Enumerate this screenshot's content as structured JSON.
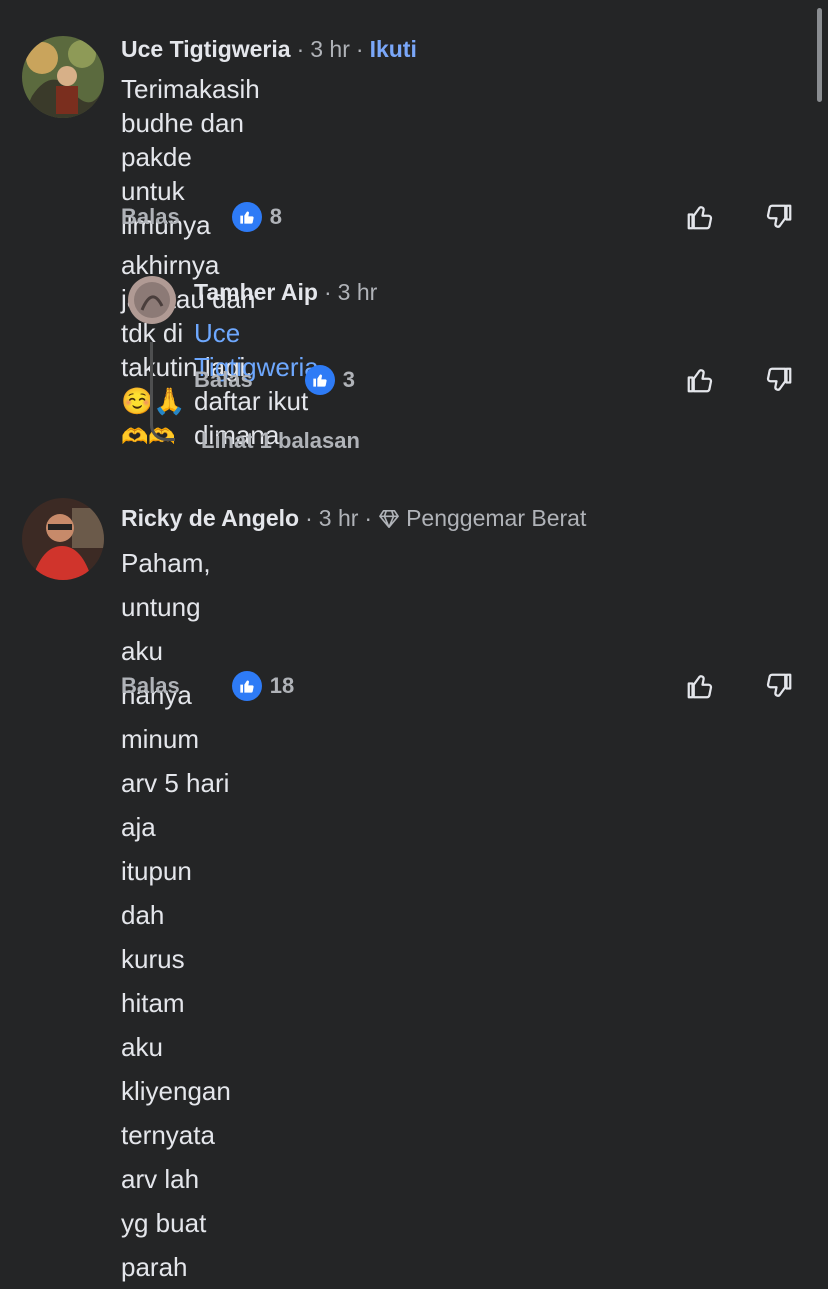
{
  "comments": [
    {
      "name": "Uce Tigtigweria",
      "time": "3 hr",
      "follow": "Ikuti",
      "line1": "Terimakasih budhe dan pakde untuk ilmunya",
      "line2": "akhirnya jadi tau dan tdk di takutin lagi. ☺️🙏",
      "line3": "🫶🫶",
      "reply": "Balas",
      "likes": "8"
    },
    {
      "name": "Tamher Aip",
      "time": "3 hr",
      "mention": "Uce Tigtigweria",
      "text": "daftar ikut dimana",
      "reply": "Balas",
      "likes": "3"
    },
    {
      "name": "Ricky de Angelo",
      "time": "3 hr",
      "badge": "Penggemar Berat",
      "line1": "Paham,  untung aku hanya minum arv 5 hari",
      "line2": "aja itupun dah kurus hitam aku kliyengan",
      "line3": "ternyata arv lah yg buat parah",
      "reply": "Balas",
      "likes": "18"
    }
  ],
  "thread": {
    "view_replies": "Lihat 1 balasan"
  },
  "icons": {
    "like": "thumbs-up-icon",
    "dislike": "thumbs-down-icon",
    "badge": "diamond-icon"
  },
  "colors": {
    "background": "#242526",
    "accent": "#2e7bf6",
    "link": "#6ea8fe"
  }
}
